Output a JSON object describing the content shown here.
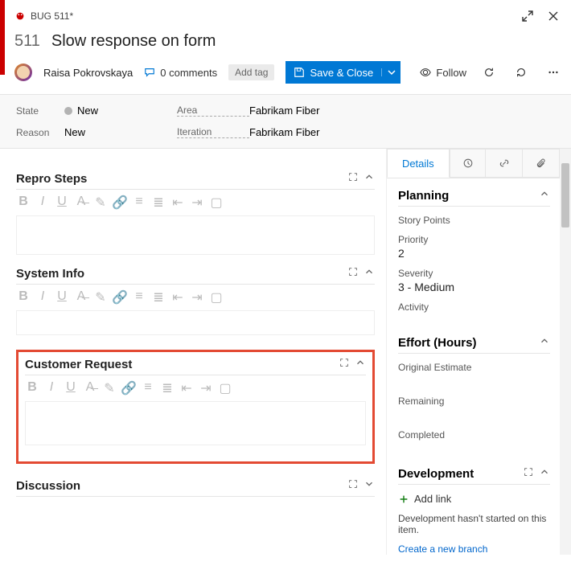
{
  "window": {
    "tab_label": "BUG 511*",
    "close_icon": "✕"
  },
  "item": {
    "id": "511",
    "title": "Slow response on form",
    "assignee": "Raisa Pokrovskaya"
  },
  "toolbar": {
    "comments": "0 comments",
    "add_tag": "Add tag",
    "save_close": "Save & Close",
    "follow": "Follow"
  },
  "state": {
    "state_label": "State",
    "state_value": "New",
    "reason_label": "Reason",
    "reason_value": "New",
    "area_label": "Area",
    "area_value": "Fabrikam Fiber",
    "iteration_label": "Iteration",
    "iteration_value": "Fabrikam Fiber"
  },
  "sections": {
    "repro": "Repro Steps",
    "system": "System Info",
    "customer": "Customer Request",
    "discussion": "Discussion"
  },
  "tabs": {
    "details": "Details"
  },
  "planning": {
    "heading": "Planning",
    "story_points": "Story Points",
    "priority_label": "Priority",
    "priority_value": "2",
    "severity_label": "Severity",
    "severity_value": "3 - Medium",
    "activity_label": "Activity"
  },
  "effort": {
    "heading": "Effort (Hours)",
    "original": "Original Estimate",
    "remaining": "Remaining",
    "completed": "Completed"
  },
  "development": {
    "heading": "Development",
    "add_link": "Add link",
    "text": "Development hasn't started on this item.",
    "create_branch": "Create a new branch"
  }
}
